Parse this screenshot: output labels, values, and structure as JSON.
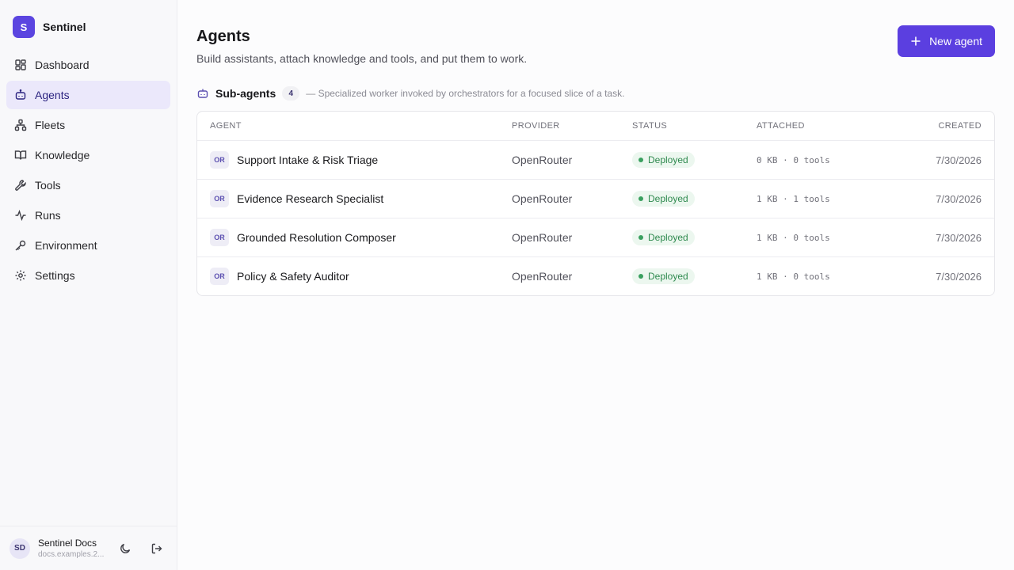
{
  "brand": {
    "logo_letter": "S",
    "name": "Sentinel"
  },
  "nav": [
    {
      "label": "Dashboard",
      "icon": "dashboard-icon",
      "active": false
    },
    {
      "label": "Agents",
      "icon": "bot-icon",
      "active": true
    },
    {
      "label": "Fleets",
      "icon": "network-icon",
      "active": false
    },
    {
      "label": "Knowledge",
      "icon": "book-icon",
      "active": false
    },
    {
      "label": "Tools",
      "icon": "wrench-icon",
      "active": false
    },
    {
      "label": "Runs",
      "icon": "activity-icon",
      "active": false
    },
    {
      "label": "Environment",
      "icon": "key-icon",
      "active": false
    },
    {
      "label": "Settings",
      "icon": "gear-icon",
      "active": false
    }
  ],
  "user": {
    "initials": "SD",
    "name": "Sentinel Docs",
    "sub": "docs.examples.2..."
  },
  "page": {
    "title": "Agents",
    "subtitle": "Build assistants, attach knowledge and tools, and put them to work.",
    "new_button": "New agent"
  },
  "section": {
    "title": "Sub-agents",
    "count": "4",
    "description": "— Specialized worker invoked by orchestrators for a focused slice of a task."
  },
  "table": {
    "headers": {
      "agent": "AGENT",
      "provider": "PROVIDER",
      "status": "STATUS",
      "attached": "ATTACHED",
      "created": "CREATED"
    },
    "rows": [
      {
        "badge": "OR",
        "name": "Support Intake & Risk Triage",
        "provider": "OpenRouter",
        "status": "Deployed",
        "attached": "0 KB · 0 tools",
        "created": "7/30/2026"
      },
      {
        "badge": "OR",
        "name": "Evidence Research Specialist",
        "provider": "OpenRouter",
        "status": "Deployed",
        "attached": "1 KB · 1 tools",
        "created": "7/30/2026"
      },
      {
        "badge": "OR",
        "name": "Grounded Resolution Composer",
        "provider": "OpenRouter",
        "status": "Deployed",
        "attached": "1 KB · 0 tools",
        "created": "7/30/2026"
      },
      {
        "badge": "OR",
        "name": "Policy & Safety Auditor",
        "provider": "OpenRouter",
        "status": "Deployed",
        "attached": "1 KB · 0 tools",
        "created": "7/30/2026"
      }
    ]
  },
  "colors": {
    "accent": "#5b3fe0",
    "status_green": "#2f8a4f",
    "active_nav_bg": "#ebe8fb"
  }
}
